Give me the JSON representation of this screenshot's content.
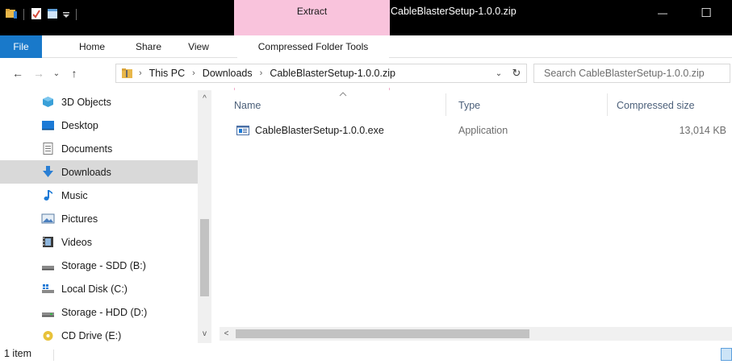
{
  "titlebar": {
    "context_tab_label": "Extract",
    "window_title": "CableBlasterSetup-1.0.0.zip",
    "minimize_glyph": "—",
    "maximize_glyph": "☐"
  },
  "ribbon": {
    "tabs": [
      {
        "label": "File"
      },
      {
        "label": "Home"
      },
      {
        "label": "Share"
      },
      {
        "label": "View"
      },
      {
        "label": "Compressed Folder Tools"
      }
    ]
  },
  "address": {
    "back_glyph": "←",
    "forward_glyph": "→",
    "recent_glyph": "⌄",
    "up_glyph": "↑",
    "crumbs": [
      "This PC",
      "Downloads",
      "CableBlasterSetup-1.0.0.zip"
    ],
    "dropdown_glyph": "⌄",
    "refresh_glyph": "↻"
  },
  "search": {
    "placeholder": "Search CableBlasterSetup-1.0.0.zip"
  },
  "nav_pane": {
    "items": [
      {
        "label": "3D Objects",
        "icon": "3d-objects-icon"
      },
      {
        "label": "Desktop",
        "icon": "desktop-icon"
      },
      {
        "label": "Documents",
        "icon": "documents-icon"
      },
      {
        "label": "Downloads",
        "icon": "downloads-icon",
        "selected": true
      },
      {
        "label": "Music",
        "icon": "music-icon"
      },
      {
        "label": "Pictures",
        "icon": "pictures-icon"
      },
      {
        "label": "Videos",
        "icon": "videos-icon"
      },
      {
        "label": "Storage - SDD (B:)",
        "icon": "drive-icon"
      },
      {
        "label": "Local Disk (C:)",
        "icon": "windows-drive-icon"
      },
      {
        "label": "Storage - HDD (D:)",
        "icon": "drive-icon"
      },
      {
        "label": "CD Drive (E:)",
        "icon": "cd-drive-icon"
      }
    ],
    "scroll_up_glyph": "^",
    "scroll_down_glyph": "v"
  },
  "content": {
    "columns": {
      "name": "Name",
      "type": "Type",
      "size": "Compressed size"
    },
    "files": [
      {
        "name": "CableBlasterSetup-1.0.0.exe",
        "type": "Application",
        "size": "13,014 KB"
      }
    ],
    "hscroll_left_glyph": "<"
  },
  "status": {
    "item_count": "1 item"
  },
  "colors": {
    "file_tab": "#1979ca",
    "context_tab": "#f9c3dc",
    "selection": "#d9d9d9",
    "column_header_text": "#4c607a"
  }
}
